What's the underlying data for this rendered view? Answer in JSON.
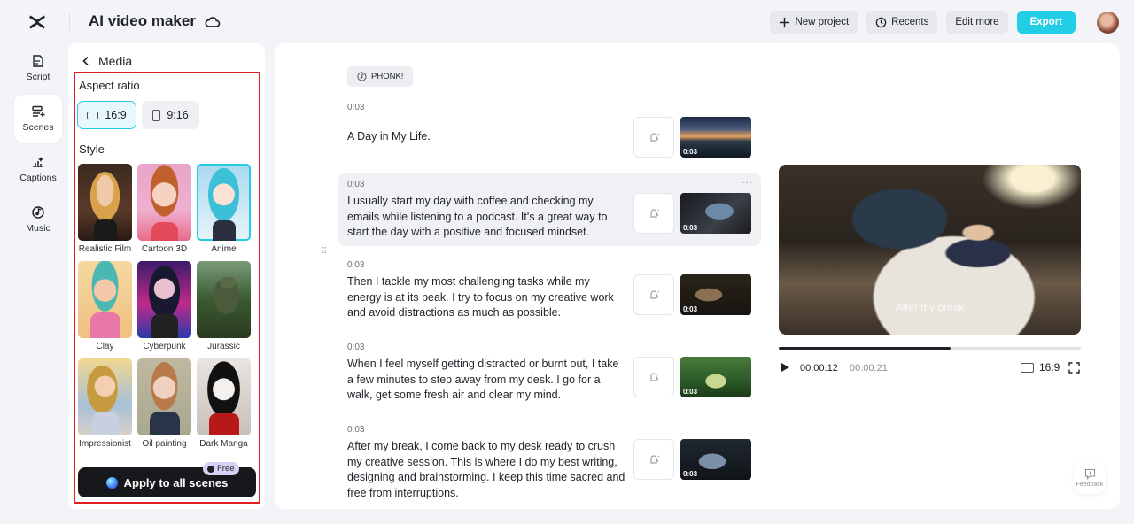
{
  "app": {
    "title": "AI video maker"
  },
  "toolbar": {
    "new_project": "New project",
    "recents": "Recents",
    "edit_more": "Edit more",
    "export": "Export"
  },
  "nav": {
    "items": [
      {
        "label": "Script",
        "icon": "script-icon"
      },
      {
        "label": "Scenes",
        "icon": "scenes-icon",
        "active": true
      },
      {
        "label": "Captions",
        "icon": "captions-icon"
      },
      {
        "label": "Music",
        "icon": "music-icon"
      }
    ]
  },
  "media": {
    "title": "Media",
    "aspect_ratio_label": "Aspect ratio",
    "ratios": [
      {
        "label": "16:9",
        "selected": true
      },
      {
        "label": "9:16",
        "selected": false
      }
    ],
    "style_label": "Style",
    "styles": [
      {
        "name": "Realistic Film"
      },
      {
        "name": "Cartoon 3D"
      },
      {
        "name": "Anime",
        "selected": true
      },
      {
        "name": "Clay"
      },
      {
        "name": "Cyberpunk"
      },
      {
        "name": "Jurassic"
      },
      {
        "name": "Impressionist"
      },
      {
        "name": "Oil painting"
      },
      {
        "name": "Dark Manga"
      }
    ],
    "apply_label": "Apply to all scenes",
    "free_badge": "Free"
  },
  "script": {
    "music_tag": "PHONK!",
    "scenes": [
      {
        "time": "0:03",
        "text": "A Day in My Life.",
        "thumb_time": "0:03"
      },
      {
        "time": "0:03",
        "text": "I usually start my day with coffee and checking my emails while listening to a podcast. It's a great way to start the day with a positive and focused mindset.",
        "thumb_time": "0:03",
        "active": true
      },
      {
        "time": "0:03",
        "text": "Then I tackle my most challenging tasks while my energy is at its peak. I try to focus on my creative work and avoid distractions as much as possible.",
        "thumb_time": "0:03"
      },
      {
        "time": "0:03",
        "text": "When I feel myself getting distracted or burnt out, I take a few minutes to step away from my desk. I go for a walk, get some fresh air and clear my mind.",
        "thumb_time": "0:03"
      },
      {
        "time": "0:03",
        "text": "After my break, I come back to my desk ready to crush my creative session. This is where I do my best writing, designing and brainstorming. I keep this time sacred and free from interruptions.",
        "thumb_time": "0:03"
      }
    ]
  },
  "player": {
    "caption": "After my break",
    "current_time": "00:00:12",
    "total_time": "00:00:21",
    "progress": 0.57,
    "aspect": "16:9"
  },
  "feedback": {
    "label": "Feedback"
  },
  "colors": {
    "accent": "#22cde6",
    "highlight_border": "#e02020",
    "apply_bg": "#16181c"
  }
}
